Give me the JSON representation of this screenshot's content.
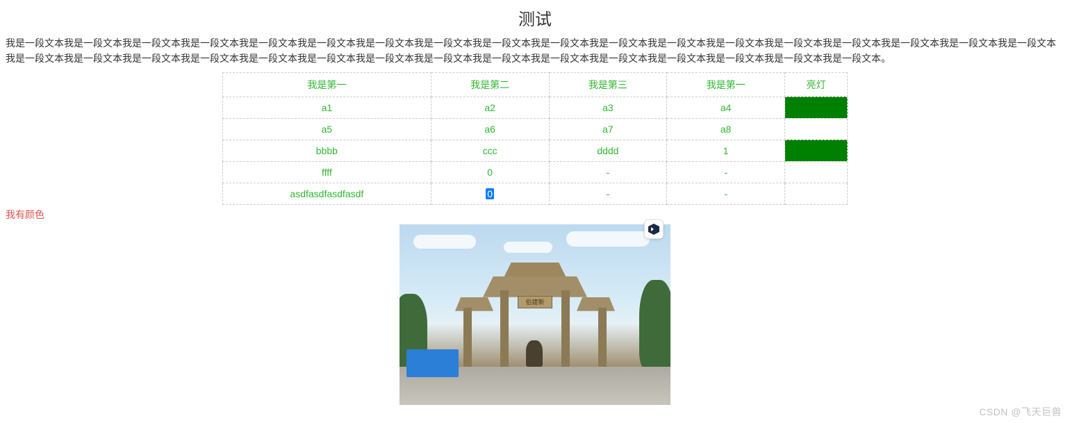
{
  "title": "测试",
  "paragraph": "我是一段文本我是一段文本我是一段文本我是一段文本我是一段文本我是一段文本我是一段文本我是一段文本我是一段文本我是一段文本我是一段文本我是一段文本我是一段文本我是一段文本我是一段文本我是一段文本我是一段文本我是一段文本我是一段文本我是一段文本我是一段文本我是一段文本我是一段文本我是一段文本我是一段文本我是一段文本我是一段文本我是一段文本我是一段文本我是一段文本我是一段文本我是一段文本我是一段文本。",
  "table": {
    "headers": [
      "我是第一",
      "我是第二",
      "我是第三",
      "我是第一",
      "亮灯"
    ],
    "rows": [
      {
        "cells": [
          "a1",
          "a2",
          "a3",
          "a4"
        ],
        "light": true
      },
      {
        "cells": [
          "a5",
          "a6",
          "a7",
          "a8"
        ],
        "light": false
      },
      {
        "cells": [
          "bbbb",
          "ccc",
          "dddd",
          "1"
        ],
        "light": true
      },
      {
        "cells": [
          "ffff",
          "0",
          "-",
          "-"
        ],
        "light": false
      },
      {
        "cells": [
          "asdfasdfasdfasdf",
          "0",
          "-",
          "-"
        ],
        "light": false,
        "selectedCol": 1
      }
    ]
  },
  "coloredText": "我有颜色",
  "plaque": "伯建新",
  "watermark": "CSDN @飞天巨兽"
}
